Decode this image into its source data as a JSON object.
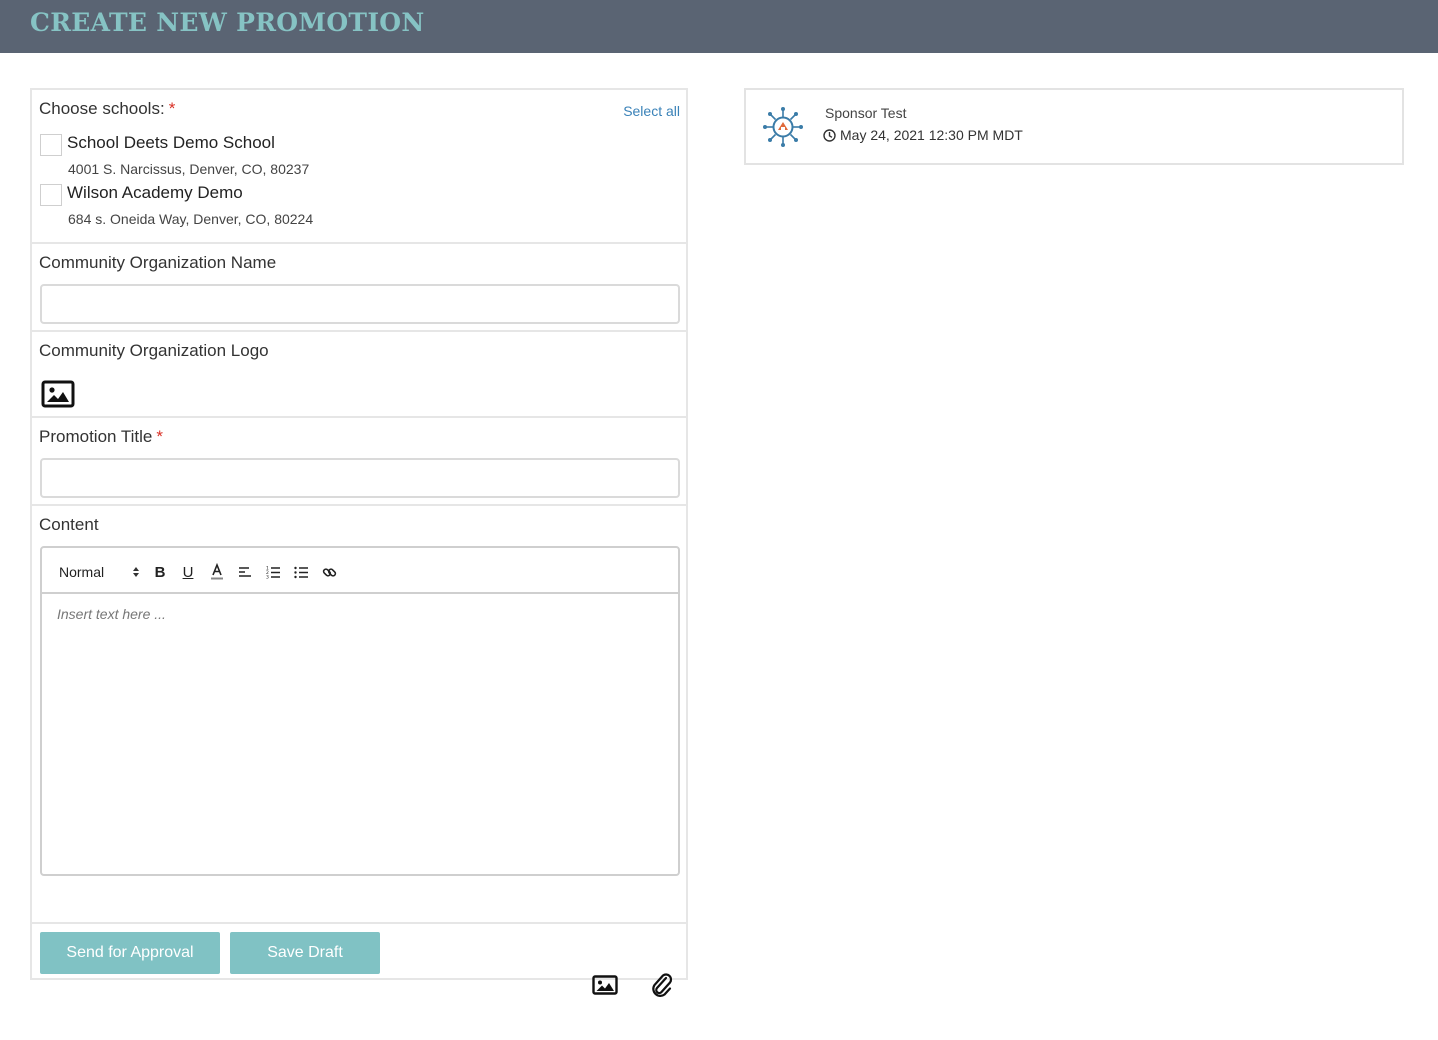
{
  "header": {
    "title": "CREATE NEW PROMOTION"
  },
  "schools": {
    "label": "Choose schools:",
    "required_mark": "*",
    "select_all": "Select all",
    "items": [
      {
        "name": "School Deets Demo School",
        "address": "4001 S. Narcissus, Denver, CO, 80237",
        "checked": false
      },
      {
        "name": "Wilson Academy Demo",
        "address": "684 s. Oneida Way, Denver, CO, 80224",
        "checked": false
      }
    ]
  },
  "org_name": {
    "label": "Community Organization Name",
    "value": ""
  },
  "org_logo": {
    "label": "Community Organization Logo",
    "icon": "image-icon"
  },
  "promo_title": {
    "label": "Promotion Title",
    "required_mark": "*",
    "value": ""
  },
  "content": {
    "label": "Content",
    "toolbar": {
      "format": "Normal",
      "bold": "B",
      "underline": "U",
      "font_color": "A"
    },
    "placeholder": "Insert text here ..."
  },
  "actions": {
    "send_for_approval": "Send for Approval",
    "save_draft": "Save Draft"
  },
  "preview": {
    "sponsor_name": "Sponsor Test",
    "date": "May 24, 2021 12:30 PM MDT"
  },
  "colors": {
    "header_bg": "#5a6473",
    "title": "#86c3c4",
    "button": "#80c2c4",
    "link": "#3a82b8",
    "required": "#d93025"
  }
}
